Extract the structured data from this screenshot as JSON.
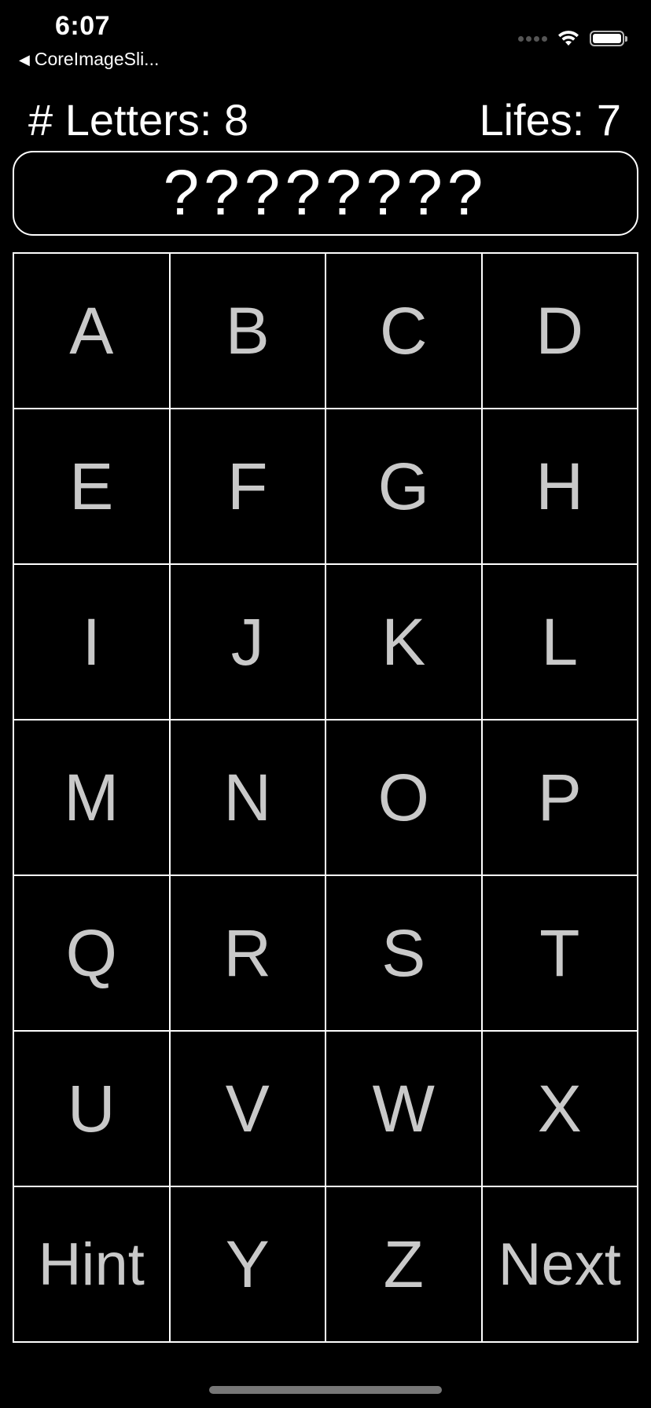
{
  "status_bar": {
    "time": "6:07",
    "back_label": "CoreImageSli...",
    "icons": [
      "signal-icon",
      "wifi-icon",
      "battery-icon"
    ]
  },
  "info": {
    "letters_label": "# Letters: 8",
    "lifes_label": "Lifes: 7"
  },
  "word": {
    "display": "????????"
  },
  "keys": [
    "A",
    "B",
    "C",
    "D",
    "E",
    "F",
    "G",
    "H",
    "I",
    "J",
    "K",
    "L",
    "M",
    "N",
    "O",
    "P",
    "Q",
    "R",
    "S",
    "T",
    "U",
    "V",
    "W",
    "X",
    "Hint",
    "Y",
    "Z",
    "Next"
  ],
  "colors": {
    "background": "#000000",
    "text": "#ffffff",
    "key_text": "#c9c9c9",
    "grid_line": "#ffffff"
  }
}
